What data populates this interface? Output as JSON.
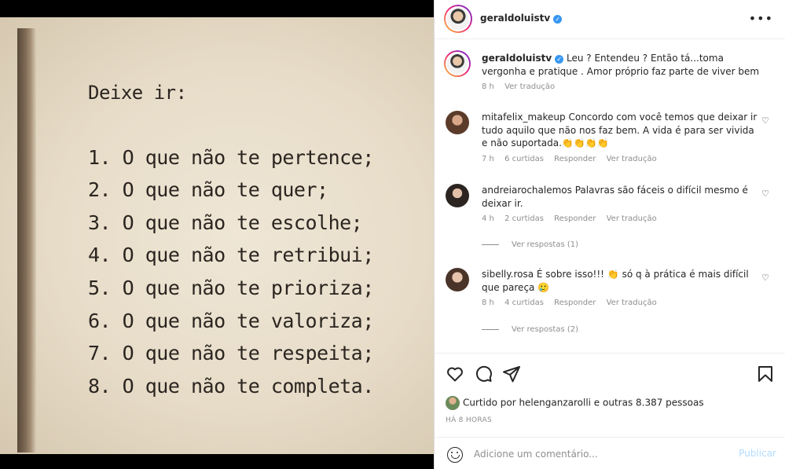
{
  "post": {
    "lines": {
      "heading": "Deixe ir:",
      "l1": "1. O que não te pertence;",
      "l2": "2. O que não te quer;",
      "l3": "3. O que não te escolhe;",
      "l4": "4. O que não te retribui;",
      "l5": "5. O que não te prioriza;",
      "l6": "6. O que não te valoriza;",
      "l7": "7. O que não te respeita;",
      "l8": "8. O que não te completa."
    }
  },
  "header": {
    "username": "geraldoluistv",
    "more_icon": "more-icon"
  },
  "caption": {
    "username": "geraldoluistv",
    "text": "Leu ? Entendeu ? Então tá...toma vergonha e pratique . Amor próprio faz parte de viver bem",
    "time": "8 h",
    "translate": "Ver tradução"
  },
  "comments": [
    {
      "username": "mitafelix_makeup",
      "text": "Concordo com você temos que deixar ir tudo aquilo que não nos faz bem. A vida é para ser vivida e não suportada.👏👏👏👏",
      "time": "7 h",
      "likes": "6 curtidas",
      "reply": "Responder",
      "translate": "Ver tradução"
    },
    {
      "username": "andreiarochalemos",
      "text": "Palavras são fáceis o difícil mesmo é deixar ir.",
      "time": "4 h",
      "likes": "2 curtidas",
      "reply": "Responder",
      "translate": "Ver tradução",
      "replies": "Ver respostas (1)"
    },
    {
      "username": "sibelly.rosa",
      "text": "É sobre isso!!! 👏 só q à prática é mais difícil que pareça 🥲",
      "time": "8 h",
      "likes": "4 curtidas",
      "reply": "Responder",
      "translate": "Ver tradução",
      "replies": "Ver respostas (2)"
    }
  ],
  "actions": {
    "liked_by": "Curtido por helenganzarolli e outras 8.387 pessoas",
    "time_ago": "HÁ 8 HORAS",
    "comment_placeholder": "Adicione um comentário...",
    "publish": "Publicar"
  },
  "colors": {
    "link_blue": "#3897f0",
    "publish_disabled": "#b3dbff",
    "secondary_text": "#8e8e8e"
  }
}
